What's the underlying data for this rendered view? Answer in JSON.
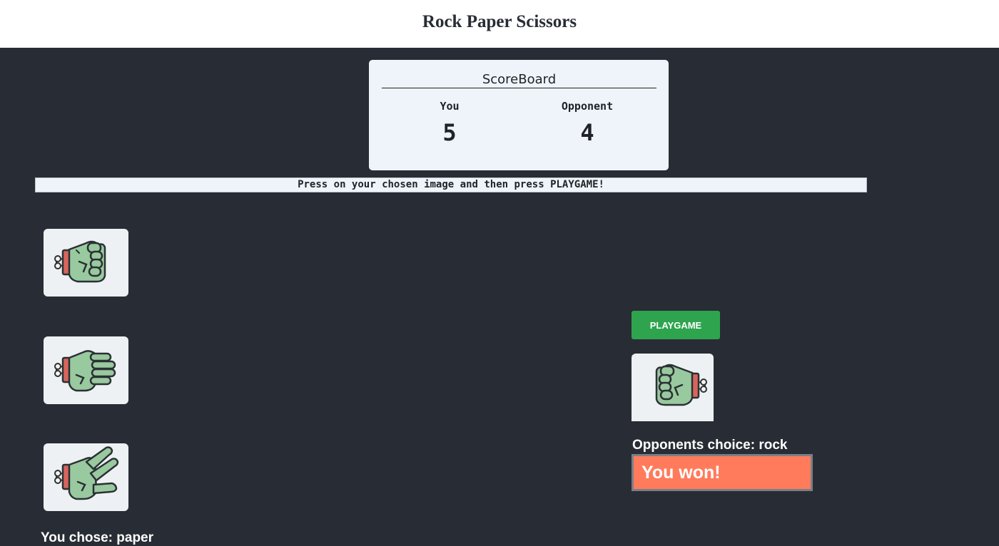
{
  "header": {
    "title": "Rock Paper Scissors"
  },
  "scoreboard": {
    "title": "ScoreBoard",
    "you_label": "You",
    "you_score": "5",
    "opponent_label": "Opponent",
    "opponent_score": "4"
  },
  "instructions": "Press on your chosen image and then press PLAYGAME!",
  "choices": [
    {
      "name": "rock",
      "icon": "zombie-fist-icon"
    },
    {
      "name": "paper",
      "icon": "zombie-open-hand-icon"
    },
    {
      "name": "scissors",
      "icon": "zombie-peace-hand-icon"
    }
  ],
  "you_chose": "You chose: paper",
  "play_button": "PLAYGAME",
  "opponent": {
    "icon": "zombie-fist-icon",
    "choice_text": "Opponents choice: rock"
  },
  "result": "You won!",
  "colors": {
    "background": "#282c34",
    "panel": "#eef4f9",
    "hand_skin": "#99c99e",
    "play_button": "#2ea44f",
    "result_banner": "#ff7b5c"
  }
}
